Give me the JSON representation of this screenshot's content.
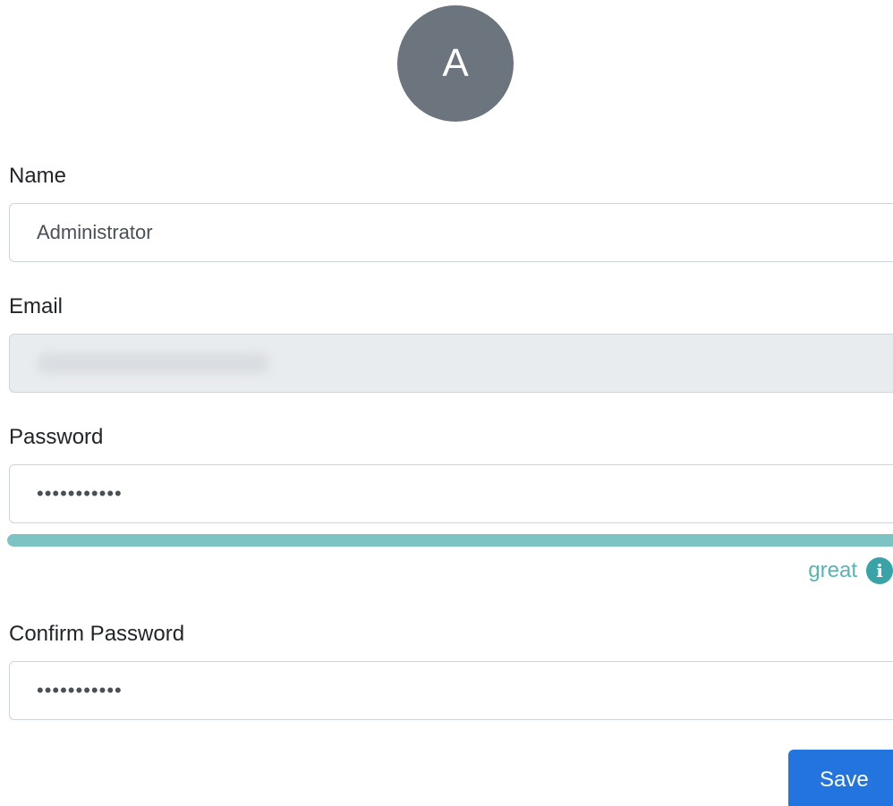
{
  "avatar": {
    "initial": "A"
  },
  "form": {
    "name": {
      "label": "Name",
      "value": "Administrator"
    },
    "email": {
      "label": "Email",
      "value": "",
      "disabled": true,
      "blurred": true
    },
    "password": {
      "label": "Password",
      "value": "•••••••••••"
    },
    "password_strength": {
      "label": "great",
      "level": 1.0,
      "color": "#7cc4c4",
      "info_icon": "info-circle-icon"
    },
    "confirm_password": {
      "label": "Confirm Password",
      "value": "•••••••••••"
    },
    "save_label": "Save"
  },
  "colors": {
    "avatar_bg": "#6c757d",
    "primary_button": "#2474e0",
    "strength_text": "#5ab3b3",
    "disabled_field": "#e9ecef"
  }
}
